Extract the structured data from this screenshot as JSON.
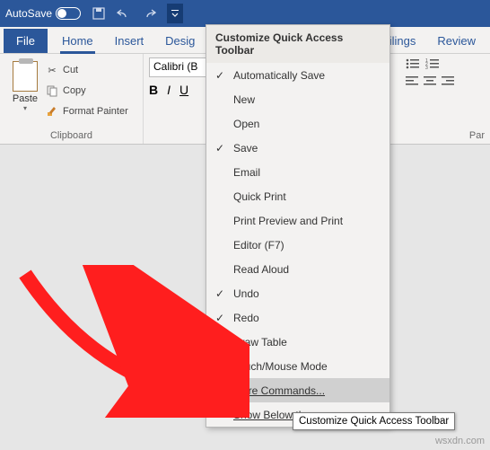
{
  "titlebar": {
    "autosave_label": "AutoSave",
    "autosave_state": "Off"
  },
  "tabs": {
    "file": "File",
    "home": "Home",
    "insert": "Insert",
    "design": "Desig",
    "mailings": "Mailings",
    "review": "Review"
  },
  "clipboard": {
    "paste": "Paste",
    "cut": "Cut",
    "copy": "Copy",
    "format_painter": "Format Painter",
    "group_label": "Clipboard"
  },
  "font": {
    "name": "Calibri (B",
    "bold": "B",
    "italic": "I",
    "underline": "U"
  },
  "paragraph": {
    "group_label": "Par"
  },
  "menu": {
    "title": "Customize Quick Access Toolbar",
    "items": [
      {
        "label": "Automatically Save",
        "checked": true
      },
      {
        "label": "New",
        "checked": false
      },
      {
        "label": "Open",
        "checked": false
      },
      {
        "label": "Save",
        "checked": true
      },
      {
        "label": "Email",
        "checked": false
      },
      {
        "label": "Quick Print",
        "checked": false
      },
      {
        "label": "Print Preview and Print",
        "checked": false
      },
      {
        "label": "Editor (F7)",
        "checked": false
      },
      {
        "label": "Read Aloud",
        "checked": false
      },
      {
        "label": "Undo",
        "checked": true
      },
      {
        "label": "Redo",
        "checked": true
      },
      {
        "label": "Draw Table",
        "checked": false
      },
      {
        "label": "Touch/Mouse Mode",
        "checked": false
      },
      {
        "label": "More Commands...",
        "checked": false,
        "hover": true,
        "underline": true
      },
      {
        "label": "Show Below th",
        "checked": false,
        "underline": true
      }
    ]
  },
  "tooltip": "Customize Quick Access Toolbar",
  "watermark": "wsxdn.com"
}
